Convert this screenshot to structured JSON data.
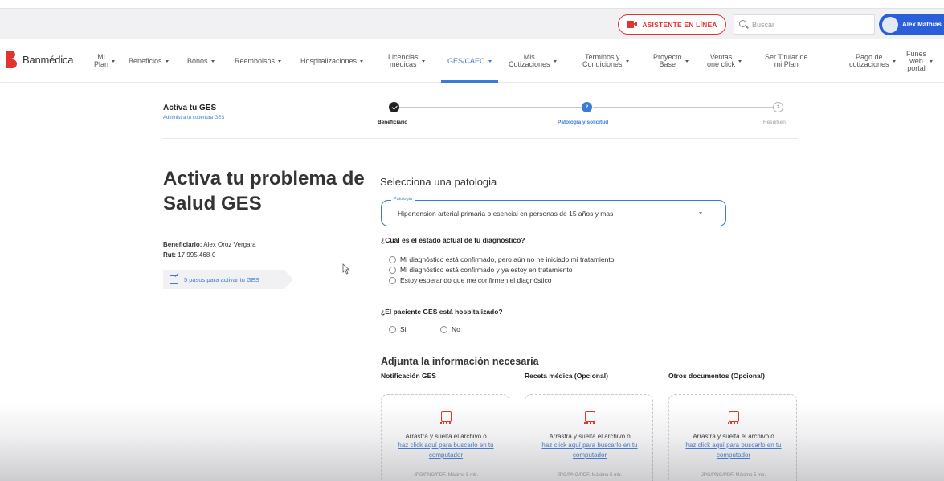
{
  "topbar": {
    "assistant_label": "ASISTENTE EN LÍNEA",
    "search_placeholder": "Buscar",
    "user_name": "Alex Mathias"
  },
  "nav": {
    "brand": "Banmédica",
    "items": [
      {
        "label": "Mi\nPlan",
        "dropdown": true
      },
      {
        "label": "Beneficios",
        "dropdown": true
      },
      {
        "label": "Bonos",
        "dropdown": true
      },
      {
        "label": "Reembolsos",
        "dropdown": true
      },
      {
        "label": "Hospitalizaciones",
        "dropdown": true
      },
      {
        "label": "Licencias\nmédicas",
        "dropdown": true
      },
      {
        "label": "GES/CAEC",
        "dropdown": true,
        "active": true
      },
      {
        "label": "Mis\nCotizaciones",
        "dropdown": true
      },
      {
        "label": "Terminos y\nCondiciones",
        "dropdown": true
      },
      {
        "label": "Proyecto\nBase",
        "dropdown": true
      },
      {
        "label": "Ventas\none click",
        "dropdown": true
      },
      {
        "label": "Ser Titular de\nmi Plan",
        "dropdown": false
      },
      {
        "label": "Pago de\ncotizaciones",
        "dropdown": true
      },
      {
        "label": "Funes\nweb\nportal",
        "dropdown": true
      }
    ]
  },
  "header": {
    "title": "Activa tu GES",
    "subtitle": "Administra tu cobertura GES",
    "steps": [
      {
        "label": "Beneficiario",
        "state": "done",
        "number": ""
      },
      {
        "label": "Patologia y solicitud",
        "state": "active",
        "number": "2"
      },
      {
        "label": "Resumen",
        "state": "todo",
        "number": "3"
      }
    ]
  },
  "left": {
    "title": "Activa tu problema de Salud GES",
    "beneficiary_label": "Beneficiario:",
    "beneficiary_name": "Alex Oroz Vergara",
    "rut_label": "Rut:",
    "rut_value": "17.995.468-0",
    "steps_link": "5 pasos para activar tu GES"
  },
  "form": {
    "section_title": "Selecciona una patologia",
    "patologia_label": "Patologia",
    "patologia_value": "Hipertension arterial primaria o esencial en personas de 15 años y mas",
    "diagnosis_question": "¿Cuál es el estado actual de tu diagnóstico?",
    "diagnosis_options": [
      "Mi diagnóstico está confirmado, pero aún no he iniciado mi tratamiento",
      "Mi diagnóstico está confirmado y ya estoy en tratamiento",
      "Estoy esperando que me confirmen el diagnóstico"
    ],
    "hospital_question": "¿El paciente GES está hospitalizado?",
    "hospital_options": [
      "Si",
      "No"
    ],
    "attach_title": "Adjunta la información necesaria",
    "uploads": [
      {
        "title": "Notificación GES"
      },
      {
        "title": "Receta médica (Opcional)"
      },
      {
        "title": "Otros documentos (Opcional)"
      }
    ],
    "upload_text": "Arrastra y suelta el archivo o",
    "upload_link": "haz click aquí para buscarlo en tu computador",
    "upload_hint": "JPG/PNG/PDF. Máximo 5 mb."
  },
  "colors": {
    "brand_red": "#e2342e",
    "accent_blue": "#3a7bd5",
    "user_pill": "#2b5fd9"
  }
}
